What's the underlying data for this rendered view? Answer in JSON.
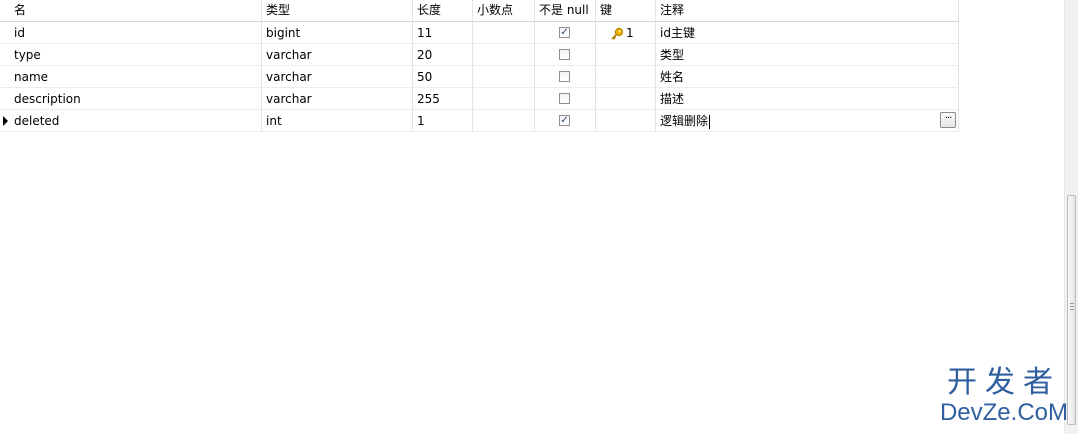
{
  "columns": {
    "name": "名",
    "type": "类型",
    "length": "长度",
    "decimal": "小数点",
    "not_null": "不是 null",
    "key": "键",
    "comment": "注释"
  },
  "rows": [
    {
      "name": "id",
      "type": "bigint",
      "length": "11",
      "decimal": "",
      "not_null": true,
      "key": "1",
      "comment": "id主键"
    },
    {
      "name": "type",
      "type": "varchar",
      "length": "20",
      "decimal": "",
      "not_null": false,
      "key": "",
      "comment": "类型"
    },
    {
      "name": "name",
      "type": "varchar",
      "length": "50",
      "decimal": "",
      "not_null": false,
      "key": "",
      "comment": "姓名"
    },
    {
      "name": "description",
      "type": "varchar",
      "length": "255",
      "decimal": "",
      "not_null": false,
      "key": "",
      "comment": "描述"
    },
    {
      "name": "deleted",
      "type": "int",
      "length": "1",
      "decimal": "",
      "not_null": true,
      "key": "",
      "comment": "逻辑删除"
    }
  ],
  "current_row_index": 4,
  "icons": {
    "row_indicator": "current-row-arrow-icon",
    "key": "key-icon",
    "checkbox_checked": "✓",
    "ellipsis": "···"
  },
  "watermark": {
    "line1": "开发者",
    "line2": "DevZe.CoM"
  }
}
